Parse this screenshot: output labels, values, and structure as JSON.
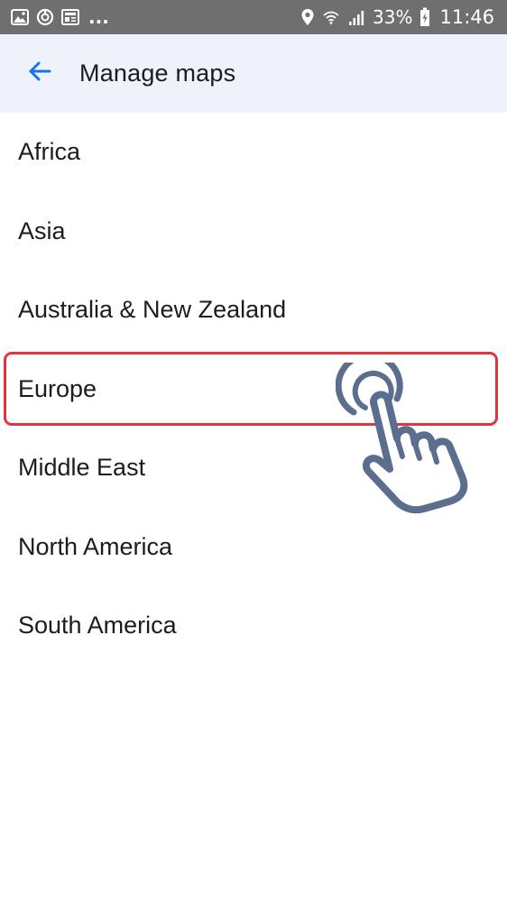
{
  "status_bar": {
    "left_icons": [
      "image-icon",
      "sync-icon",
      "news-icon"
    ],
    "overflow": "...",
    "right_icons": [
      "location-icon",
      "wifi-icon",
      "signal-icon"
    ],
    "battery": "33%",
    "time": "11:46"
  },
  "app_bar": {
    "back_icon": "arrow-left-icon",
    "title": "Manage maps",
    "accent_color": "#1a73e8"
  },
  "regions": [
    {
      "label": "Africa"
    },
    {
      "label": "Asia"
    },
    {
      "label": "Australia & New Zealand"
    },
    {
      "label": "Europe"
    },
    {
      "label": "Middle East"
    },
    {
      "label": "North America"
    },
    {
      "label": "South America"
    }
  ],
  "annotation": {
    "highlighted_item": "Europe",
    "highlight_color": "#e0343f",
    "pointer_icon": "tap-hand-icon",
    "pointer_color": "#5b6e8e"
  }
}
